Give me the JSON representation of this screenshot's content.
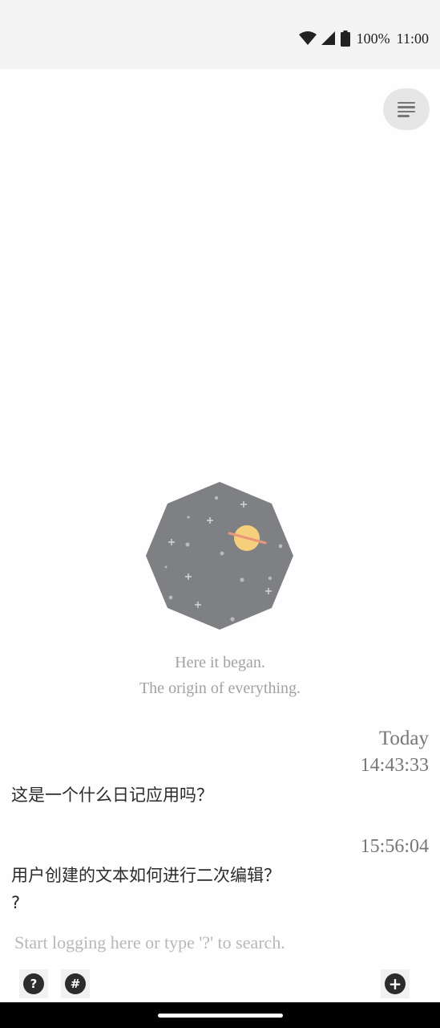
{
  "status_bar": {
    "battery": "100%",
    "time": "11:00",
    "icons": [
      "wifi-icon",
      "signal-icon",
      "battery-icon"
    ]
  },
  "header": {
    "menu_icon": "menu-icon"
  },
  "hero": {
    "line1": "Here it began.",
    "line2": "The origin of everything."
  },
  "log": {
    "date_label": "Today",
    "entries": [
      {
        "time": "14:43:33",
        "lines": [
          "这是一个什么日记应用吗？"
        ]
      },
      {
        "time": "15:56:04",
        "lines": [
          "用户创建的文本如何进行二次编辑？",
          "?"
        ]
      }
    ]
  },
  "input": {
    "placeholder": "Start logging here or type '?' to search.",
    "value": ""
  },
  "toolbar": {
    "help_label": "?",
    "tag_label": "#",
    "add_label": "+"
  },
  "colors": {
    "background": "#fefefe",
    "status_bar": "#f4f4f4",
    "illustration": "#7f8083",
    "planet": "#f5cf7b",
    "planet_ring": "#e8977a",
    "muted_text": "#a2a2a2"
  }
}
